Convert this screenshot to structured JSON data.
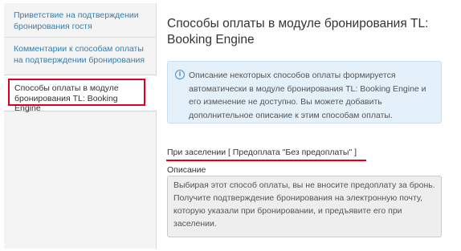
{
  "sidebar": {
    "items": [
      {
        "label": "Приветствие на подтверждении бронирования гостя"
      },
      {
        "label": "Комментарии к способам оплаты на подтверждении бронирования"
      },
      {
        "label": "Способы оплаты в модуле бронирования TL: Booking Engine"
      }
    ],
    "active_index": 2
  },
  "main": {
    "title": "Способы оплаты в модуле бронирования TL: Booking Engine",
    "info_icon": "info-icon",
    "info_text": "Описание некоторых способов оплаты формируется автоматически в модуле бронирования TL: Booking Engine и его изменение не доступно. Вы можете добавить дополнительное описание к этим способам оплаты.",
    "method_title": "При заселении [ Предоплата \"Без предоплаты\" ]",
    "description_label": "Описание",
    "description_value": "Выбирая этот способ оплаты, вы не вносите предоплату за бронь. Получите подтверждение бронирования на электронную почту, которую указали при бронировании, и предъявите его при заселении."
  },
  "colors": {
    "link": "#2f7fb5",
    "highlight": "#e0001b",
    "info_bg": "#e4f0fa",
    "text": "#333333"
  }
}
